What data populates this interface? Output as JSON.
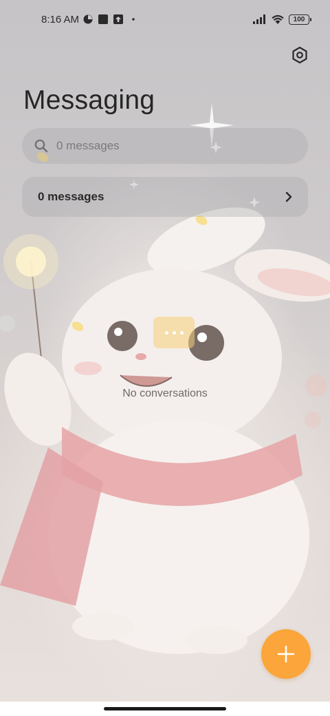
{
  "status_bar": {
    "time": "8:16 AM",
    "battery": "100",
    "icons": [
      "dot-icon",
      "square-icon",
      "upload-icon",
      "small-dot-icon",
      "signal-icon",
      "wifi-icon",
      "battery-icon"
    ]
  },
  "header": {
    "title": "Messaging",
    "settings_icon": "hexagon-settings-icon"
  },
  "search": {
    "placeholder": "0 messages",
    "icon": "search-icon"
  },
  "messages_row": {
    "label": "0 messages",
    "icon": "chevron-right-icon"
  },
  "empty_state": {
    "text": "No conversations",
    "icon": "chat-bubble-icon"
  },
  "fab": {
    "icon": "plus-icon"
  },
  "colors": {
    "accent": "#fba53a",
    "title": "#262626",
    "muted": "#7a7a7e"
  }
}
